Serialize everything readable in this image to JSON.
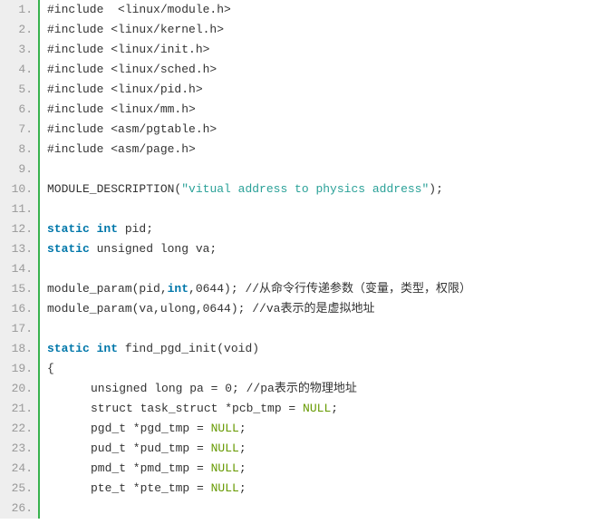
{
  "code": {
    "lines": [
      {
        "n": "1.",
        "segments": [
          {
            "t": "#include  <linux/module.h>",
            "c": "tok-preproc"
          }
        ]
      },
      {
        "n": "2.",
        "segments": [
          {
            "t": "#include <linux/kernel.h>",
            "c": "tok-preproc"
          }
        ]
      },
      {
        "n": "3.",
        "segments": [
          {
            "t": "#include <linux/init.h>",
            "c": "tok-preproc"
          }
        ]
      },
      {
        "n": "4.",
        "segments": [
          {
            "t": "#include <linux/sched.h>",
            "c": "tok-preproc"
          }
        ]
      },
      {
        "n": "5.",
        "segments": [
          {
            "t": "#include <linux/pid.h>",
            "c": "tok-preproc"
          }
        ]
      },
      {
        "n": "6.",
        "segments": [
          {
            "t": "#include <linux/mm.h>",
            "c": "tok-preproc"
          }
        ]
      },
      {
        "n": "7.",
        "segments": [
          {
            "t": "#include <asm/pgtable.h>",
            "c": "tok-preproc"
          }
        ]
      },
      {
        "n": "8.",
        "segments": [
          {
            "t": "#include <asm/page.h>",
            "c": "tok-preproc"
          }
        ]
      },
      {
        "n": "9.",
        "segments": [
          {
            "t": " ",
            "c": ""
          }
        ]
      },
      {
        "n": "10.",
        "segments": [
          {
            "t": "MODULE_DESCRIPTION(",
            "c": "tok-ident"
          },
          {
            "t": "\"vitual address to physics address\"",
            "c": "tok-string"
          },
          {
            "t": ");",
            "c": "tok-ident"
          }
        ]
      },
      {
        "n": "11.",
        "segments": [
          {
            "t": " ",
            "c": ""
          }
        ]
      },
      {
        "n": "12.",
        "segments": [
          {
            "t": "static int",
            "c": "tok-keyword"
          },
          {
            "t": " pid;",
            "c": "tok-ident"
          }
        ]
      },
      {
        "n": "13.",
        "segments": [
          {
            "t": "static",
            "c": "tok-keyword"
          },
          {
            "t": " unsigned long va;",
            "c": "tok-ident"
          }
        ]
      },
      {
        "n": "14.",
        "segments": [
          {
            "t": " ",
            "c": ""
          }
        ]
      },
      {
        "n": "15.",
        "segments": [
          {
            "t": "module_param(pid,",
            "c": "tok-ident"
          },
          {
            "t": "int",
            "c": "tok-keyword"
          },
          {
            "t": ",0644); //从命令行传递参数（变量，类型，权限）",
            "c": "tok-ident"
          }
        ]
      },
      {
        "n": "16.",
        "segments": [
          {
            "t": "module_param(va,ulong,0644); //va表示的是虚拟地址",
            "c": "tok-ident"
          }
        ]
      },
      {
        "n": "17.",
        "segments": [
          {
            "t": " ",
            "c": ""
          }
        ]
      },
      {
        "n": "18.",
        "segments": [
          {
            "t": "static int",
            "c": "tok-keyword"
          },
          {
            "t": " find_pgd_init(void)",
            "c": "tok-ident"
          }
        ]
      },
      {
        "n": "19.",
        "segments": [
          {
            "t": "{",
            "c": "tok-punct"
          }
        ]
      },
      {
        "n": "20.",
        "indent": 1,
        "segments": [
          {
            "t": "unsigned long pa = 0; //pa表示的物理地址",
            "c": "tok-ident"
          }
        ]
      },
      {
        "n": "21.",
        "indent": 1,
        "segments": [
          {
            "t": "struct task_struct *pcb_tmp = ",
            "c": "tok-ident"
          },
          {
            "t": "NULL",
            "c": "tok-constant"
          },
          {
            "t": ";",
            "c": "tok-punct"
          }
        ]
      },
      {
        "n": "22.",
        "indent": 1,
        "segments": [
          {
            "t": "pgd_t *pgd_tmp = ",
            "c": "tok-ident"
          },
          {
            "t": "NULL",
            "c": "tok-constant"
          },
          {
            "t": ";",
            "c": "tok-punct"
          }
        ]
      },
      {
        "n": "23.",
        "indent": 1,
        "segments": [
          {
            "t": "pud_t *pud_tmp = ",
            "c": "tok-ident"
          },
          {
            "t": "NULL",
            "c": "tok-constant"
          },
          {
            "t": ";",
            "c": "tok-punct"
          }
        ]
      },
      {
        "n": "24.",
        "indent": 1,
        "segments": [
          {
            "t": "pmd_t *pmd_tmp = ",
            "c": "tok-ident"
          },
          {
            "t": "NULL",
            "c": "tok-constant"
          },
          {
            "t": ";",
            "c": "tok-punct"
          }
        ]
      },
      {
        "n": "25.",
        "indent": 1,
        "segments": [
          {
            "t": "pte_t *pte_tmp = ",
            "c": "tok-ident"
          },
          {
            "t": "NULL",
            "c": "tok-constant"
          },
          {
            "t": ";",
            "c": "tok-punct"
          }
        ]
      },
      {
        "n": "26.",
        "segments": [
          {
            "t": " ",
            "c": ""
          }
        ]
      }
    ]
  }
}
